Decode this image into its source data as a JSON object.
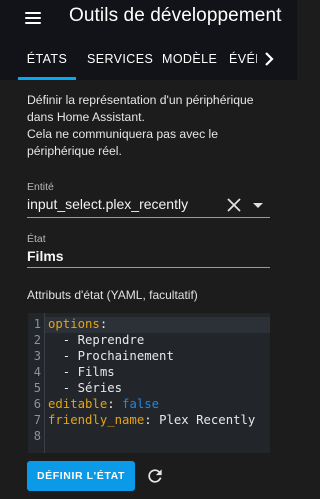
{
  "header": {
    "title": "Outils de développement",
    "menu_icon": "menu-icon"
  },
  "tabs": [
    {
      "label": "ÉTATS",
      "active": true
    },
    {
      "label": "SERVICES",
      "active": false
    },
    {
      "label": "MODÈLE",
      "active": false
    },
    {
      "label": "ÉVÉNEMENTS",
      "active": false
    }
  ],
  "description": {
    "line1": "Définir la représentation d'un périphérique dans Home Assistant.",
    "line2": "Cela ne communiquera pas avec le périphérique réel."
  },
  "entity": {
    "label": "Entité",
    "value": "input_select.plex_recently"
  },
  "state": {
    "label": "État",
    "value": "Films"
  },
  "attributes": {
    "label": "Attributs d'état (YAML, facultatif)",
    "line_numbers": [
      "1",
      "2",
      "3",
      "4",
      "5",
      "6",
      "7",
      "8"
    ],
    "lines": [
      {
        "key": "options",
        "sep": ":",
        "value": ""
      },
      {
        "key": "",
        "sep": "",
        "value": "  - Reprendre"
      },
      {
        "key": "",
        "sep": "",
        "value": "  - Prochainement"
      },
      {
        "key": "",
        "sep": "",
        "value": "  - Films"
      },
      {
        "key": "",
        "sep": "",
        "value": "  - Séries"
      },
      {
        "key": "editable",
        "sep": ": ",
        "value": "false"
      },
      {
        "key": "friendly_name",
        "sep": ": ",
        "value": "Plex Recently"
      },
      {
        "key": "",
        "sep": "",
        "value": ""
      }
    ]
  },
  "actions": {
    "submit_label": "DÉFINIR L'ÉTAT",
    "refresh_icon": "refresh-icon"
  },
  "colors": {
    "accent": "#03a9f4",
    "button": "#0a9ae8",
    "yaml_key": "#e6a40f",
    "yaml_bool": "#1e88e5"
  }
}
